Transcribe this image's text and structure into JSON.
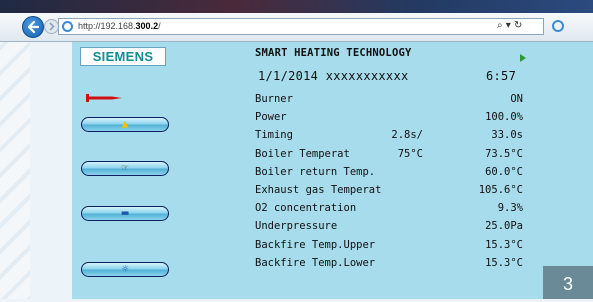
{
  "browser": {
    "url_prefix": "http://192.168.",
    "url_bold": "300.2",
    "url_suffix": "/",
    "address_controls": "⌕ ▾ ↻"
  },
  "sidebar": {
    "logo_text": "SIEMENS",
    "buttons": [
      {
        "name": "nav-button-burner",
        "icon": "flame-icon",
        "glyph": "▲",
        "glyph_color": "#f2c200"
      },
      {
        "name": "nav-button-settings",
        "icon": "hand-icon",
        "glyph": "☞",
        "glyph_color": "#333333"
      },
      {
        "name": "nav-button-display",
        "icon": "display-icon",
        "glyph": "▬",
        "glyph_color": "#2255aa"
      },
      {
        "name": "nav-button-power",
        "icon": "power-icon",
        "glyph": "☼",
        "glyph_color": "#2255aa"
      }
    ]
  },
  "main": {
    "title": "SMART HEATING TECHNOLOGY",
    "date": "1/1/2014 xxxxxxxxxxx",
    "time": "6:57",
    "rows": [
      {
        "label": "Burner",
        "mid": "",
        "value": "ON"
      },
      {
        "label": "Power",
        "mid": "",
        "value": "100.0%"
      },
      {
        "label": "Timing",
        "mid": "2.8s/",
        "value": "33.0s"
      },
      {
        "label": "Boiler Temperat",
        "mid": "75°C",
        "value": "73.5°C"
      },
      {
        "label": "Boiler return Temp.",
        "mid": "",
        "value": "60.0°C"
      },
      {
        "label": "Exhaust gas Temperat",
        "mid": "",
        "value": "105.6°C"
      },
      {
        "label": "O2 concentration",
        "mid": "",
        "value": "9.3%"
      },
      {
        "label": "Underpressure",
        "mid": "",
        "value": "25.0Pa"
      },
      {
        "label": "Backfire Temp.Upper",
        "mid": "",
        "value": "15.3°C"
      },
      {
        "label": "Backfire Temp.Lower",
        "mid": "",
        "value": "15.3°C"
      }
    ]
  },
  "page_number": "3",
  "colors": {
    "panel": "#a7dcec",
    "logo_text": "#0f8f93",
    "burner_symbol": "#d01010",
    "page_badge": "#6a8a97"
  }
}
